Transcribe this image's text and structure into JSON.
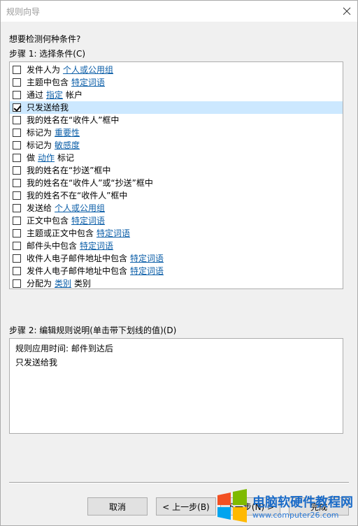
{
  "window": {
    "title": "规则向导"
  },
  "question": "想要检测何种条件?",
  "step1": {
    "label": "步骤 1: 选择条件(C)",
    "conditions": [
      {
        "pre": "发件人为",
        "link": "个人或公用组",
        "post": "",
        "checked": false,
        "selected": false
      },
      {
        "pre": "主题中包含",
        "link": "特定词语",
        "post": "",
        "checked": false,
        "selected": false
      },
      {
        "pre": "通过",
        "link": "指定",
        "post": "帐户",
        "checked": false,
        "selected": false
      },
      {
        "pre": "只发送给我",
        "link": "",
        "post": "",
        "checked": true,
        "selected": true
      },
      {
        "pre": "我的姓名在“收件人”框中",
        "link": "",
        "post": "",
        "checked": false,
        "selected": false
      },
      {
        "pre": "标记为",
        "link": "重要性",
        "post": "",
        "checked": false,
        "selected": false
      },
      {
        "pre": "标记为",
        "link": "敏感度",
        "post": "",
        "checked": false,
        "selected": false
      },
      {
        "pre": "做",
        "link": "动作",
        "post": "标记",
        "checked": false,
        "selected": false
      },
      {
        "pre": "我的姓名在“抄送”框中",
        "link": "",
        "post": "",
        "checked": false,
        "selected": false
      },
      {
        "pre": "我的姓名在“收件人”或“抄送”框中",
        "link": "",
        "post": "",
        "checked": false,
        "selected": false
      },
      {
        "pre": "我的姓名不在“收件人”框中",
        "link": "",
        "post": "",
        "checked": false,
        "selected": false
      },
      {
        "pre": "发送给",
        "link": "个人或公用组",
        "post": "",
        "checked": false,
        "selected": false
      },
      {
        "pre": "正文中包含",
        "link": "特定词语",
        "post": "",
        "checked": false,
        "selected": false
      },
      {
        "pre": "主题或正文中包含",
        "link": "特定词语",
        "post": "",
        "checked": false,
        "selected": false
      },
      {
        "pre": "邮件头中包含",
        "link": "特定词语",
        "post": "",
        "checked": false,
        "selected": false
      },
      {
        "pre": "收件人电子邮件地址中包含",
        "link": "特定词语",
        "post": "",
        "checked": false,
        "selected": false
      },
      {
        "pre": "发件人电子邮件地址中包含",
        "link": "特定词语",
        "post": "",
        "checked": false,
        "selected": false
      },
      {
        "pre": "分配为",
        "link": "类别",
        "post": "类别",
        "checked": false,
        "selected": false
      }
    ]
  },
  "step2": {
    "label": "步骤 2: 编辑规则说明(单击带下划线的值)(D)",
    "lines": [
      "规则应用时间: 邮件到达后",
      "只发送给我"
    ]
  },
  "buttons": {
    "cancel": "取消",
    "back": "< 上一步(B)",
    "next": "下一步(N) >",
    "finish": "完成"
  },
  "watermark": {
    "title": "电脑软硬件教程网",
    "url": "www.computer26.com"
  },
  "colors": {
    "selection": "#cce8ff",
    "link": "#0b5ea8",
    "dialog_bg": "#f0f0f0"
  }
}
